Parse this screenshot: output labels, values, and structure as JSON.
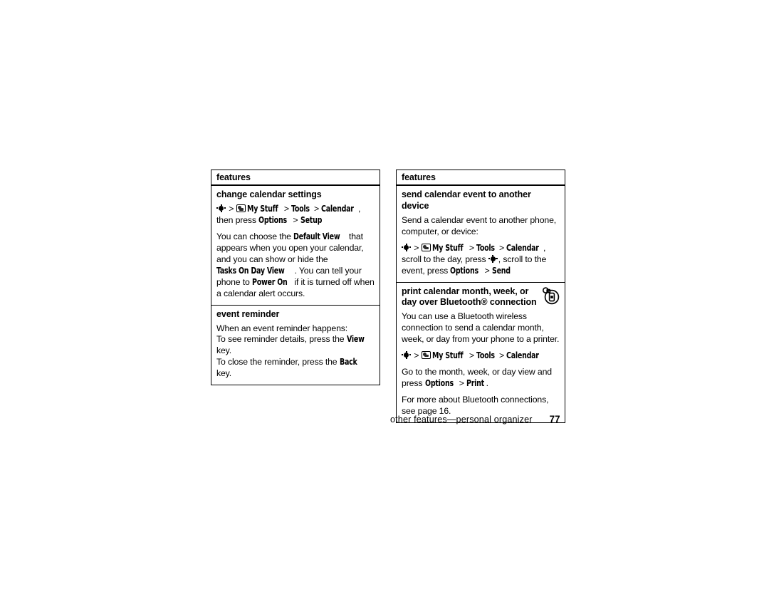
{
  "page": {
    "footer_text": "other features—personal organizer",
    "page_number": "77"
  },
  "icons": {
    "nav_key": "nav-key-icon",
    "my_stuff": "my-stuff-icon",
    "bluetooth_print": "bluetooth-print-icon"
  },
  "left_box": {
    "header": "features",
    "sections": [
      {
        "title": "change calendar settings",
        "paragraphs": [
          {
            "parts": [
              {
                "type": "icon",
                "name": "nav-key"
              },
              {
                "type": "text",
                "text": " "
              },
              {
                "type": "gt",
                "text": ">"
              },
              {
                "type": "text",
                "text": " "
              },
              {
                "type": "icon",
                "name": "my-stuff"
              },
              {
                "type": "ui",
                "text": "My Stuff"
              },
              {
                "type": "text",
                "text": " "
              },
              {
                "type": "gt",
                "text": ">"
              },
              {
                "type": "text",
                "text": " "
              },
              {
                "type": "ui",
                "text": "Tools"
              },
              {
                "type": "text",
                "text": " "
              },
              {
                "type": "gt",
                "text": ">"
              },
              {
                "type": "text",
                "text": " "
              },
              {
                "type": "ui",
                "text": "Calendar"
              },
              {
                "type": "text",
                "text": ", then press "
              },
              {
                "type": "ui",
                "text": "Options"
              },
              {
                "type": "text",
                "text": " "
              },
              {
                "type": "gt",
                "text": ">"
              },
              {
                "type": "text",
                "text": " "
              },
              {
                "type": "ui",
                "text": "Setup"
              }
            ]
          },
          {
            "parts": [
              {
                "type": "text",
                "text": "You can choose the "
              },
              {
                "type": "ui",
                "text": "Default View"
              },
              {
                "type": "text",
                "text": " that appears when you open your calendar, and you can show or hide the "
              },
              {
                "type": "ui",
                "text": "Tasks On Day View"
              },
              {
                "type": "text",
                "text": ". You can tell your phone to "
              },
              {
                "type": "ui",
                "text": "Power On"
              },
              {
                "type": "text",
                "text": " if it is turned off when a calendar alert occurs."
              }
            ]
          }
        ]
      },
      {
        "title": "event reminder",
        "paragraphs": [
          {
            "parts": [
              {
                "type": "text",
                "text": "When an event reminder happens:"
              },
              {
                "type": "br"
              },
              {
                "type": "text",
                "text": "To see reminder details, press the "
              },
              {
                "type": "ui",
                "text": "View"
              },
              {
                "type": "text",
                "text": " key."
              },
              {
                "type": "br"
              },
              {
                "type": "text",
                "text": "To close the reminder, press the "
              },
              {
                "type": "ui",
                "text": "Back"
              },
              {
                "type": "text",
                "text": " key."
              }
            ]
          }
        ]
      }
    ]
  },
  "right_box": {
    "header": "features",
    "sections": [
      {
        "title": "send calendar event to another device",
        "paragraphs": [
          {
            "parts": [
              {
                "type": "text",
                "text": "Send a calendar event to another phone, computer, or device:"
              }
            ]
          },
          {
            "parts": [
              {
                "type": "icon",
                "name": "nav-key"
              },
              {
                "type": "text",
                "text": " "
              },
              {
                "type": "gt",
                "text": ">"
              },
              {
                "type": "text",
                "text": " "
              },
              {
                "type": "icon",
                "name": "my-stuff"
              },
              {
                "type": "ui",
                "text": "My Stuff"
              },
              {
                "type": "text",
                "text": " "
              },
              {
                "type": "gt",
                "text": ">"
              },
              {
                "type": "text",
                "text": " "
              },
              {
                "type": "ui",
                "text": "Tools"
              },
              {
                "type": "text",
                "text": " "
              },
              {
                "type": "gt",
                "text": ">"
              },
              {
                "type": "text",
                "text": " "
              },
              {
                "type": "ui",
                "text": "Calendar"
              },
              {
                "type": "text",
                "text": ", scroll to the day, press "
              },
              {
                "type": "icon",
                "name": "nav-key"
              },
              {
                "type": "text",
                "text": ", scroll to the event, press "
              },
              {
                "type": "ui",
                "text": "Options"
              },
              {
                "type": "text",
                "text": " "
              },
              {
                "type": "gt",
                "text": ">"
              },
              {
                "type": "text",
                "text": " "
              },
              {
                "type": "ui",
                "text": "Send"
              }
            ]
          }
        ]
      },
      {
        "title": "print calendar month, week, or day over Bluetooth® connection",
        "icon": "bluetooth-print",
        "paragraphs": [
          {
            "parts": [
              {
                "type": "text",
                "text": "You can use a Bluetooth wireless connection to send a calendar month, week, or day from your phone to a printer."
              }
            ]
          },
          {
            "parts": [
              {
                "type": "icon",
                "name": "nav-key"
              },
              {
                "type": "text",
                "text": " "
              },
              {
                "type": "gt",
                "text": ">"
              },
              {
                "type": "text",
                "text": " "
              },
              {
                "type": "icon",
                "name": "my-stuff"
              },
              {
                "type": "ui",
                "text": "My Stuff"
              },
              {
                "type": "text",
                "text": " "
              },
              {
                "type": "gt",
                "text": ">"
              },
              {
                "type": "text",
                "text": " "
              },
              {
                "type": "ui",
                "text": "Tools"
              },
              {
                "type": "text",
                "text": " "
              },
              {
                "type": "gt",
                "text": ">"
              },
              {
                "type": "text",
                "text": " "
              },
              {
                "type": "ui",
                "text": "Calendar"
              }
            ]
          },
          {
            "parts": [
              {
                "type": "text",
                "text": "Go to the month, week, or day view and press "
              },
              {
                "type": "ui",
                "text": "Options"
              },
              {
                "type": "text",
                "text": " "
              },
              {
                "type": "gt",
                "text": ">"
              },
              {
                "type": "text",
                "text": " "
              },
              {
                "type": "ui",
                "text": "Print"
              },
              {
                "type": "text",
                "text": "."
              }
            ]
          },
          {
            "parts": [
              {
                "type": "text",
                "text": "For more about Bluetooth connections, see page 16."
              }
            ]
          }
        ]
      }
    ]
  }
}
